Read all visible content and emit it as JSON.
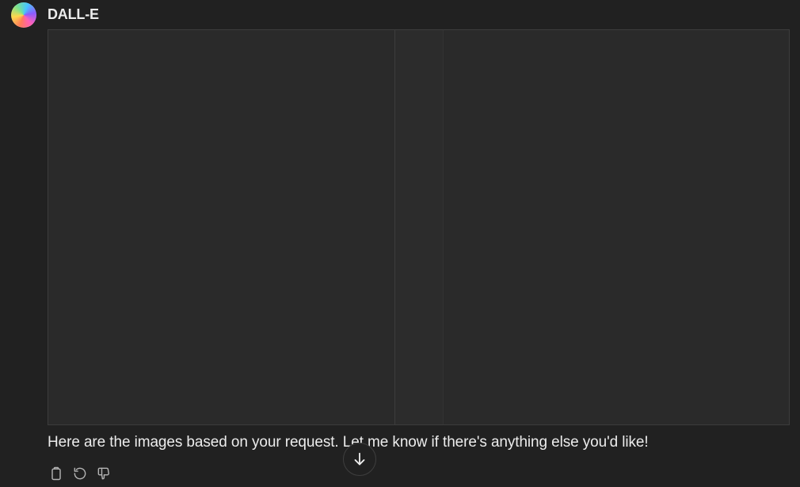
{
  "sender": {
    "name": "DALL-E",
    "avatar_icon": "dalle-avatar-icon"
  },
  "message": {
    "text": "Here are the images based on your request. Let me know if there's anything else you'd like!"
  },
  "actions": {
    "copy_icon": "clipboard-icon",
    "regenerate_icon": "regenerate-icon",
    "dislike_icon": "thumbs-down-icon"
  },
  "scroll": {
    "icon": "arrow-down-icon"
  },
  "colors": {
    "background": "#212121",
    "image_placeholder": "#2a2a2a",
    "text": "#ececec",
    "icon": "#b4b4b4"
  }
}
